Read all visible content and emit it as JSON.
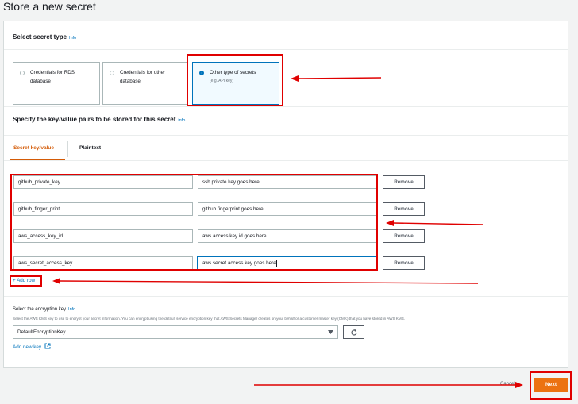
{
  "page": {
    "title": "Store a new secret"
  },
  "secret_type": {
    "heading": "Select secret type",
    "info": "Info",
    "options": [
      {
        "label_line1": "Credentials for RDS",
        "label_line2": "database",
        "selected": false
      },
      {
        "label_line1": "Credentials for other",
        "label_line2": "database",
        "selected": false
      },
      {
        "label_line1": "Other type of secrets",
        "desc": "(e.g. API key)",
        "selected": true
      }
    ]
  },
  "kv": {
    "heading": "Specify the key/value pairs to be stored for this secret",
    "info": "info",
    "tabs": [
      "Secret key/value",
      "Plaintext"
    ],
    "rows": [
      {
        "key": "github_private_key",
        "value": "ssh private key goes here",
        "remove": "Remove"
      },
      {
        "key": "github_finger_print",
        "value": "github fingerprint goes here",
        "remove": "Remove"
      },
      {
        "key": "aws_access_key_id",
        "value": "aws access key id goes here",
        "remove": "Remove"
      },
      {
        "key": "aws_secret_access_key",
        "value": "aws secret access key goes here",
        "remove": "Remove"
      }
    ],
    "add_row": "+ Add row"
  },
  "encryption": {
    "label": "Select the encryption key",
    "info": "Info",
    "description": "Select the AWS KMS key to use to encrypt your secret information. You can encrypt using the default service encryption key that AWS Secrets Manager creates on your behalf or a customer master key (CMK) that you have stored in AWS KMS.",
    "selected": "DefaultEncryptionKey",
    "add_key": "Add new key"
  },
  "footer": {
    "cancel": "Cancel",
    "next": "Next"
  },
  "colors": {
    "accent": "#ec7211",
    "link": "#0073bb",
    "annotation": "#e00000"
  }
}
